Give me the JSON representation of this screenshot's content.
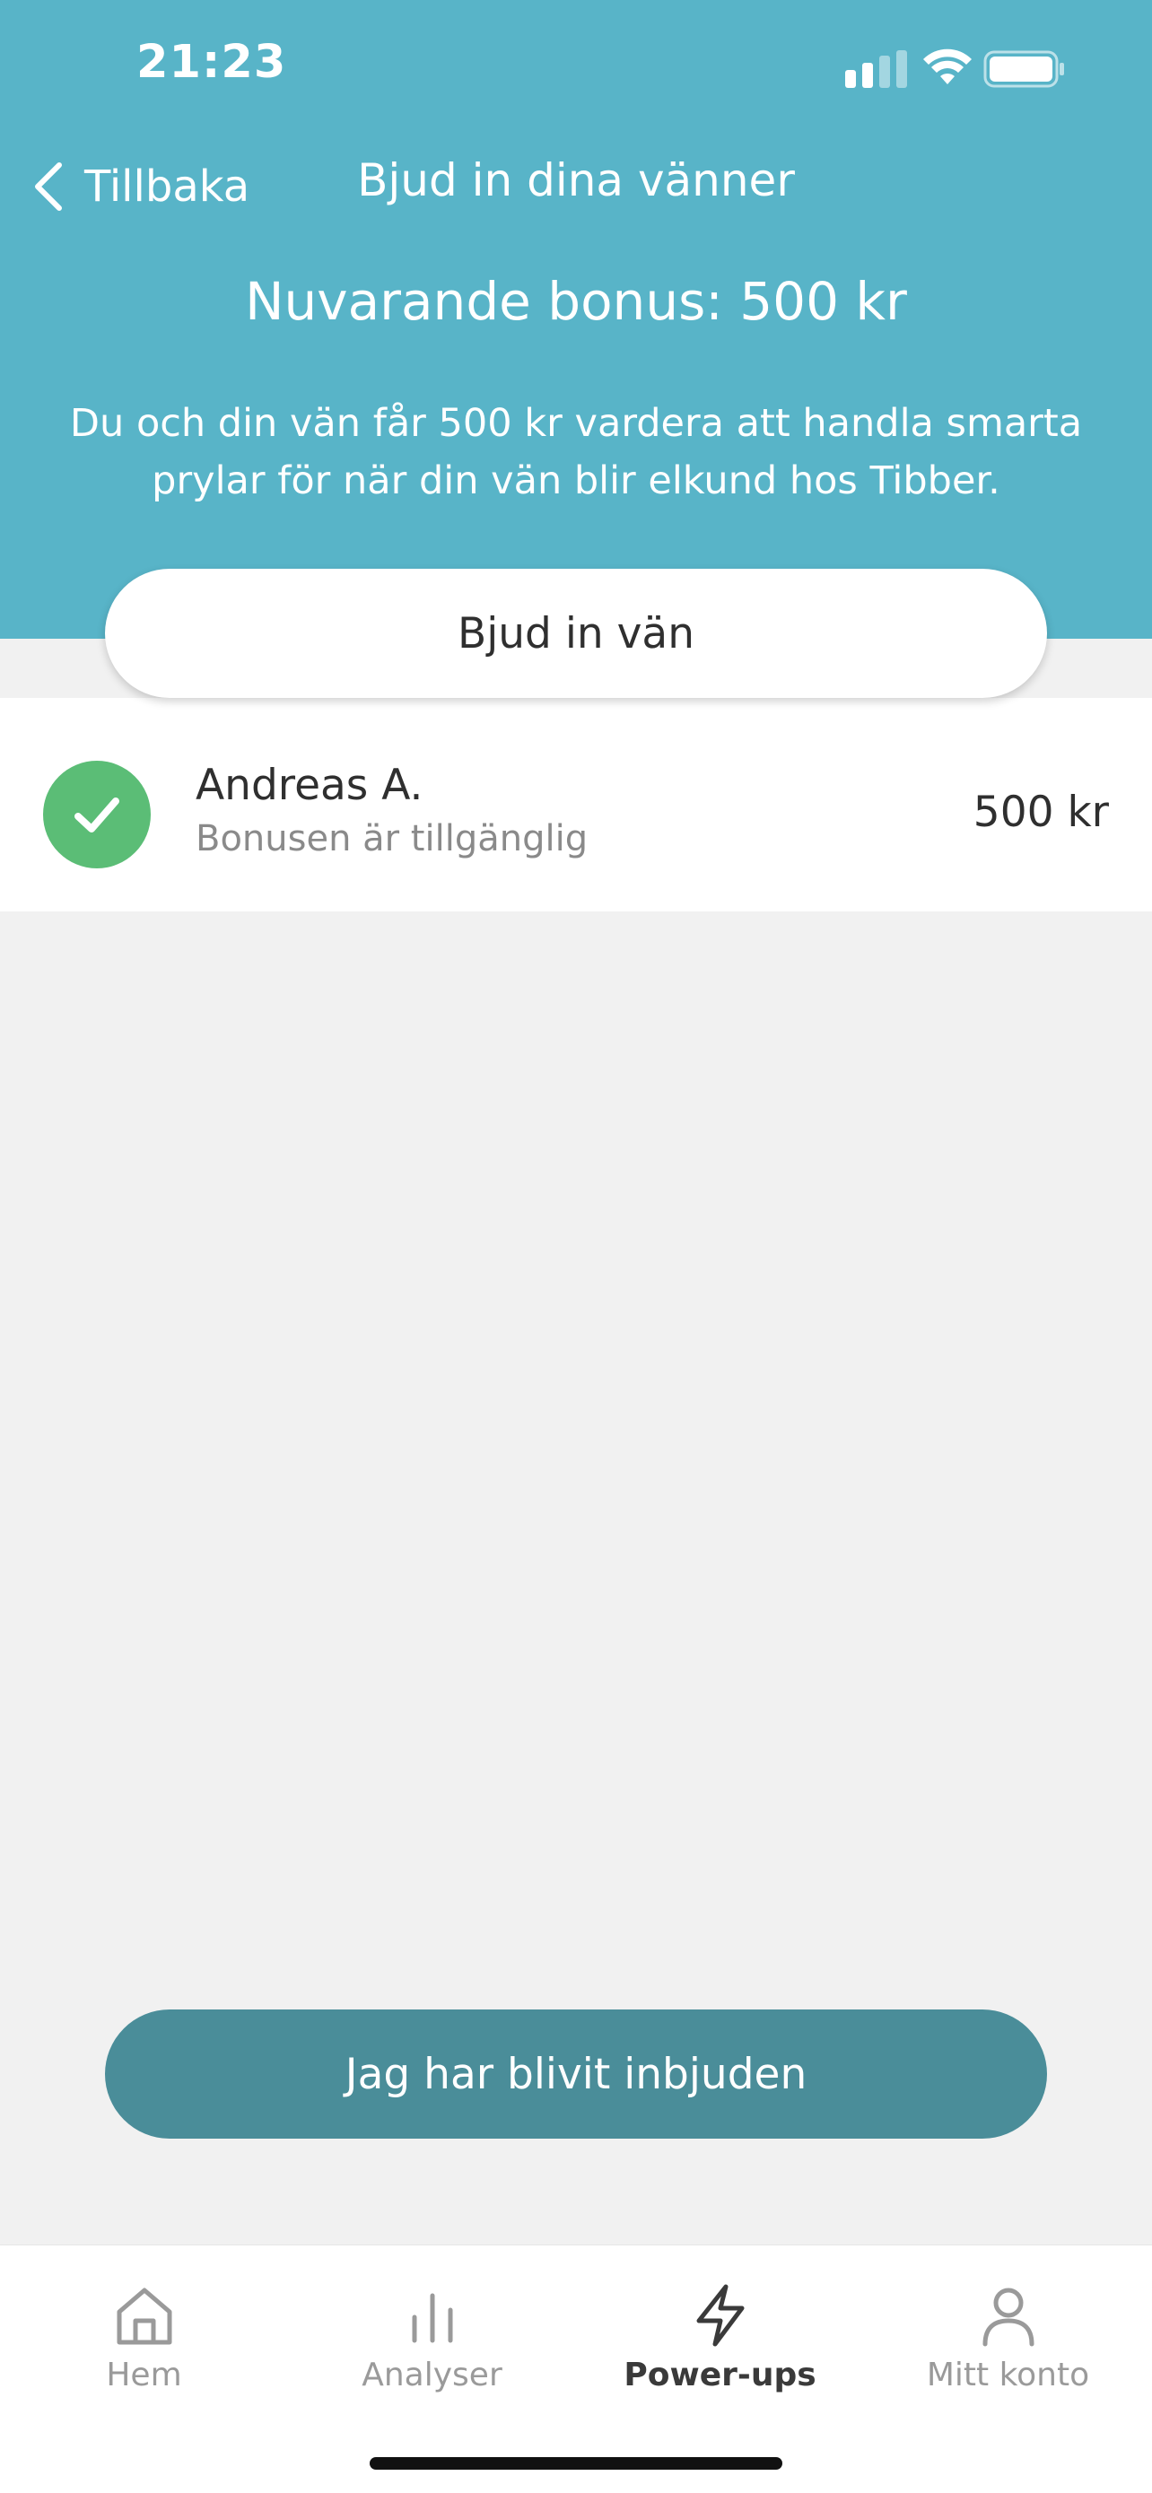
{
  "status_bar": {
    "time": "21:23",
    "icons": [
      "signal-icon",
      "wifi-icon",
      "battery-icon"
    ]
  },
  "nav": {
    "back_label": "Tillbaka",
    "title": "Bjud in dina vänner"
  },
  "bonus": {
    "title": "Nuvarande bonus: 500 kr",
    "description": "Du och din vän får 500 kr vardera att handla smarta prylar för när din vän blir elkund hos Tibber."
  },
  "invite_button_label": "Bjud in vän",
  "friends": [
    {
      "name": "Andreas A.",
      "status": "Bonusen är tillgänglig",
      "amount": "500 kr",
      "icon": "check-icon"
    }
  ],
  "invited_button_label": "Jag har blivit inbjuden",
  "tabs": [
    {
      "label": "Hem",
      "icon": "home-icon",
      "active": false
    },
    {
      "label": "Analyser",
      "icon": "bar-chart-icon",
      "active": false
    },
    {
      "label": "Power-ups",
      "icon": "lightning-icon",
      "active": true
    },
    {
      "label": "Mitt konto",
      "icon": "person-icon",
      "active": false
    }
  ],
  "colors": {
    "header": "#58b4c8",
    "primary_button": "#4a8d99",
    "success": "#5bbd76",
    "background": "#f1f1f1"
  }
}
